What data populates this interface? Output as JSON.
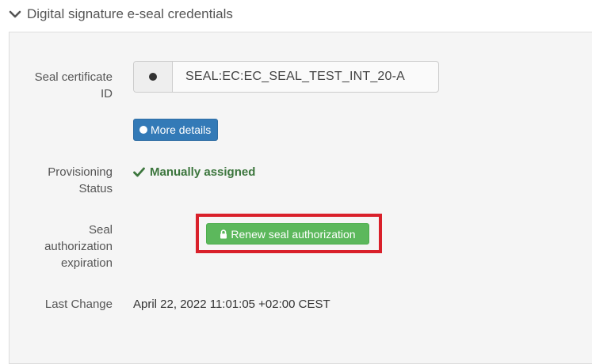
{
  "section": {
    "title": "Digital signature e-seal credentials",
    "icon": "chevron-down-icon"
  },
  "fields": {
    "seal_certificate_id": {
      "label_line1": "Seal certificate",
      "label_line2": "ID",
      "value": "SEAL:EC:EC_SEAL_TEST_INT_20-A",
      "addon_icon": "circle-icon"
    },
    "more_details_button": {
      "label": "More details",
      "icon": "circle-icon",
      "color": "#337ab7"
    },
    "provisioning_status": {
      "label_line1": "Provisioning",
      "label_line2": "Status",
      "value": "Manually assigned",
      "icon": "check-icon",
      "color": "#3c763d"
    },
    "seal_authorization_expiration": {
      "label_line1": "Seal",
      "label_line2": "authorization",
      "label_line3": "expiration",
      "button_label": "Renew seal authorization",
      "button_icon": "lock-icon",
      "button_color": "#5cb85c",
      "highlight_color": "#d9202a"
    },
    "last_change": {
      "label": "Last Change",
      "value": "April 22, 2022 11:01:05 +02:00 CEST"
    }
  }
}
